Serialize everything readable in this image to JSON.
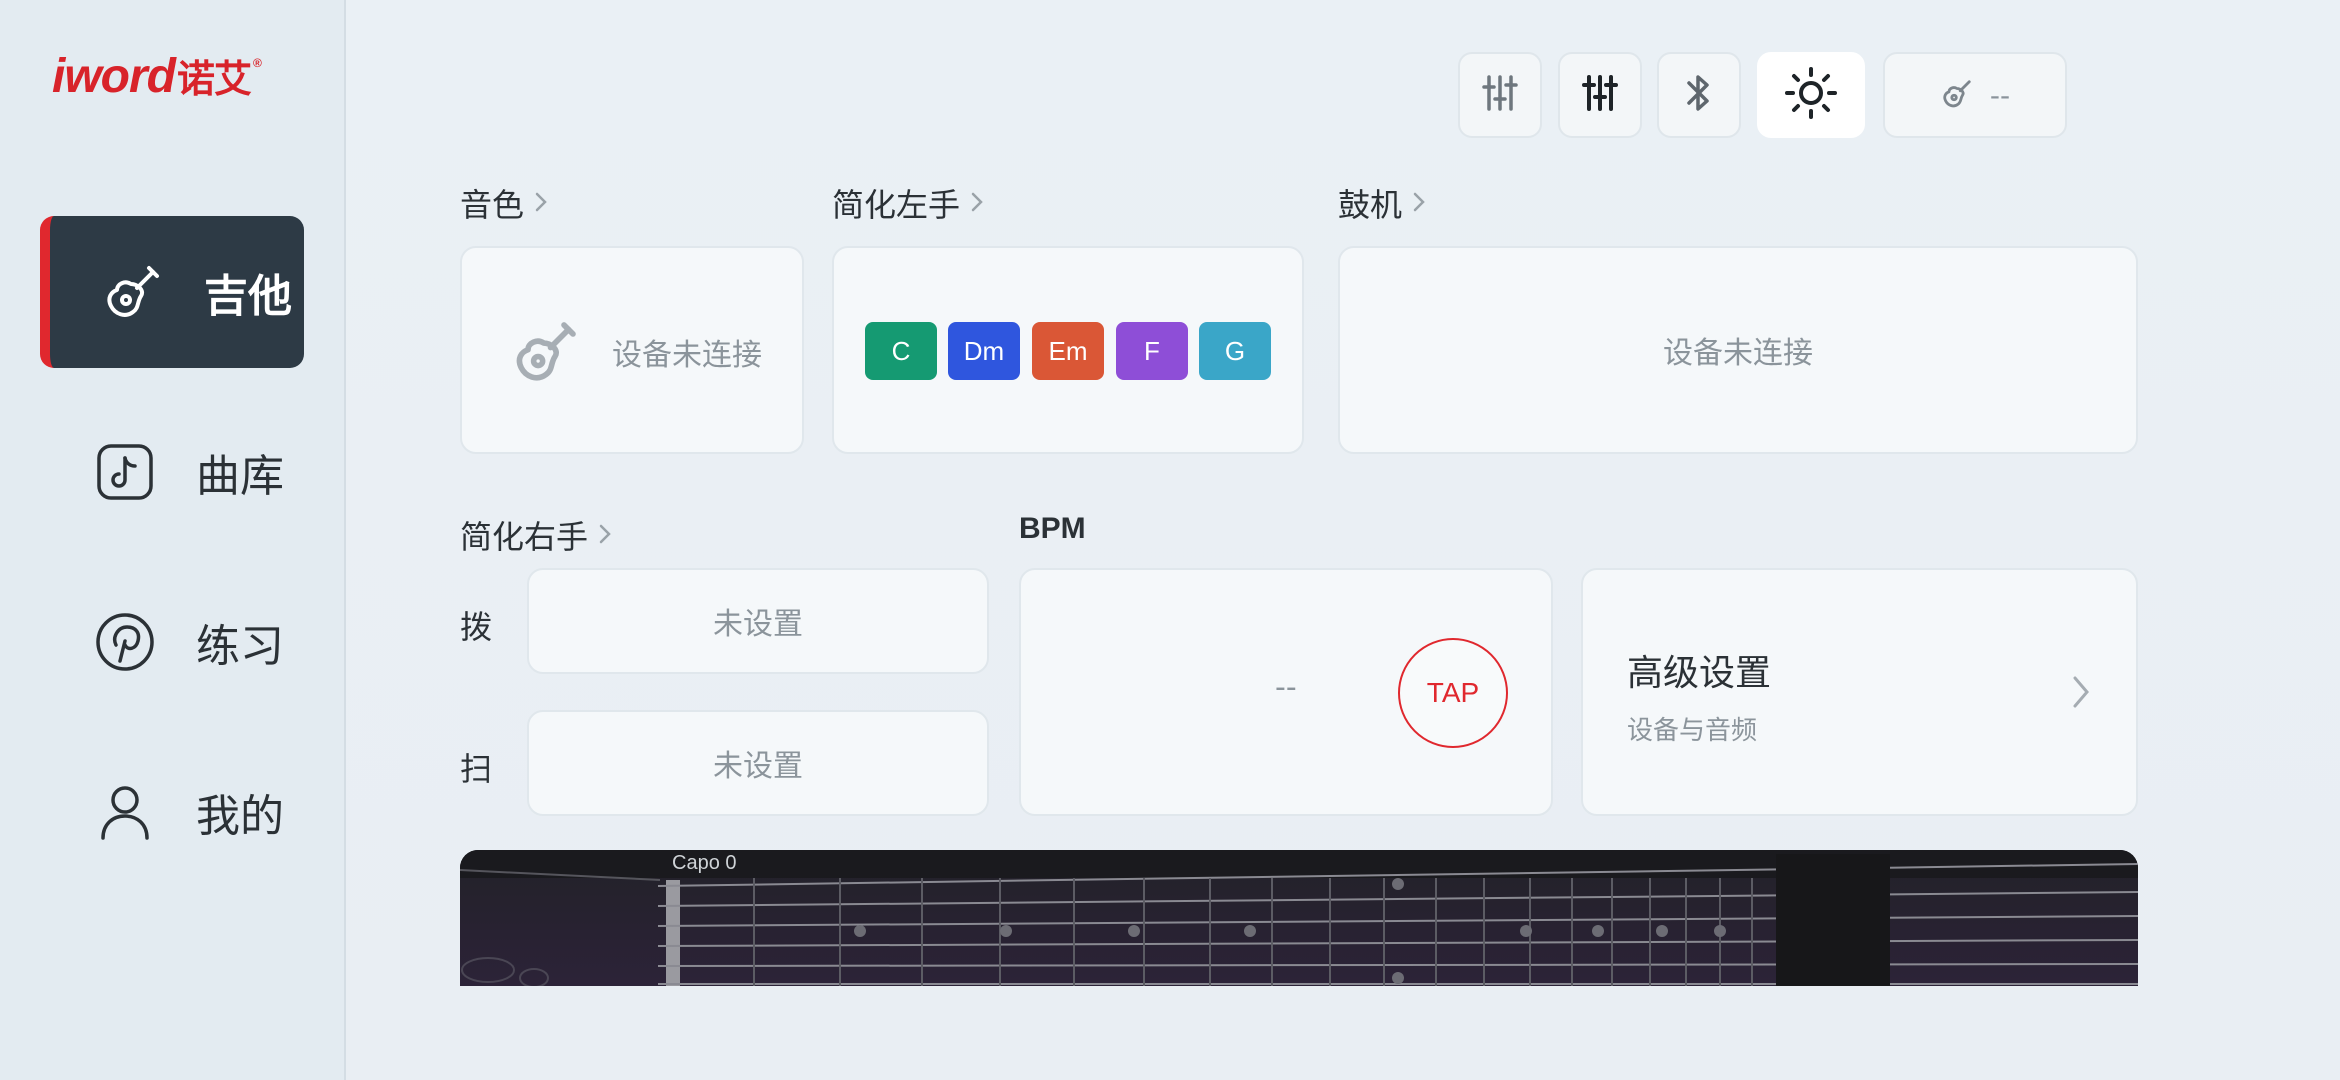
{
  "logo": {
    "brand": "iword",
    "cn": "诺艾",
    "reg": "®"
  },
  "sidebar": {
    "items": [
      {
        "label": "吉他",
        "icon": "guitar-icon",
        "active": true
      },
      {
        "label": "曲库",
        "icon": "tiktok-music-icon",
        "active": false
      },
      {
        "label": "练习",
        "icon": "pinterest-icon",
        "active": false
      },
      {
        "label": "我的",
        "icon": "user-icon",
        "active": false
      }
    ]
  },
  "toolbar": {
    "buttons": [
      {
        "icon": "equalizer-sliders-icon"
      },
      {
        "icon": "mixer-sliders-icon"
      },
      {
        "icon": "bluetooth-icon"
      },
      {
        "icon": "brightness-icon",
        "active": true
      },
      {
        "icon": "guitar-device-icon",
        "text": "--"
      }
    ]
  },
  "sections": {
    "tone": {
      "title": "音色",
      "status": "设备未连接"
    },
    "left_hand": {
      "title": "简化左手",
      "chords": [
        {
          "name": "C",
          "color": "#159a72"
        },
        {
          "name": "Dm",
          "color": "#2f56de"
        },
        {
          "name": "Em",
          "color": "#da5736"
        },
        {
          "name": "F",
          "color": "#8e4ed7"
        },
        {
          "name": "G",
          "color": "#3aa6c8"
        }
      ]
    },
    "drum": {
      "title": "鼓机",
      "status": "设备未连接"
    },
    "right_hand": {
      "title": "简化右手",
      "pluck_label": "拨",
      "pluck_value": "未设置",
      "strum_label": "扫",
      "strum_value": "未设置"
    },
    "bpm": {
      "title": "BPM",
      "value": "--",
      "tap": "TAP"
    },
    "advanced": {
      "title": "高级设置",
      "subtitle": "设备与音频"
    }
  },
  "fretboard": {
    "capo": "Capo 0"
  },
  "colors": {
    "accent": "#e0282e",
    "sidebar_active": "#2d3a45"
  }
}
